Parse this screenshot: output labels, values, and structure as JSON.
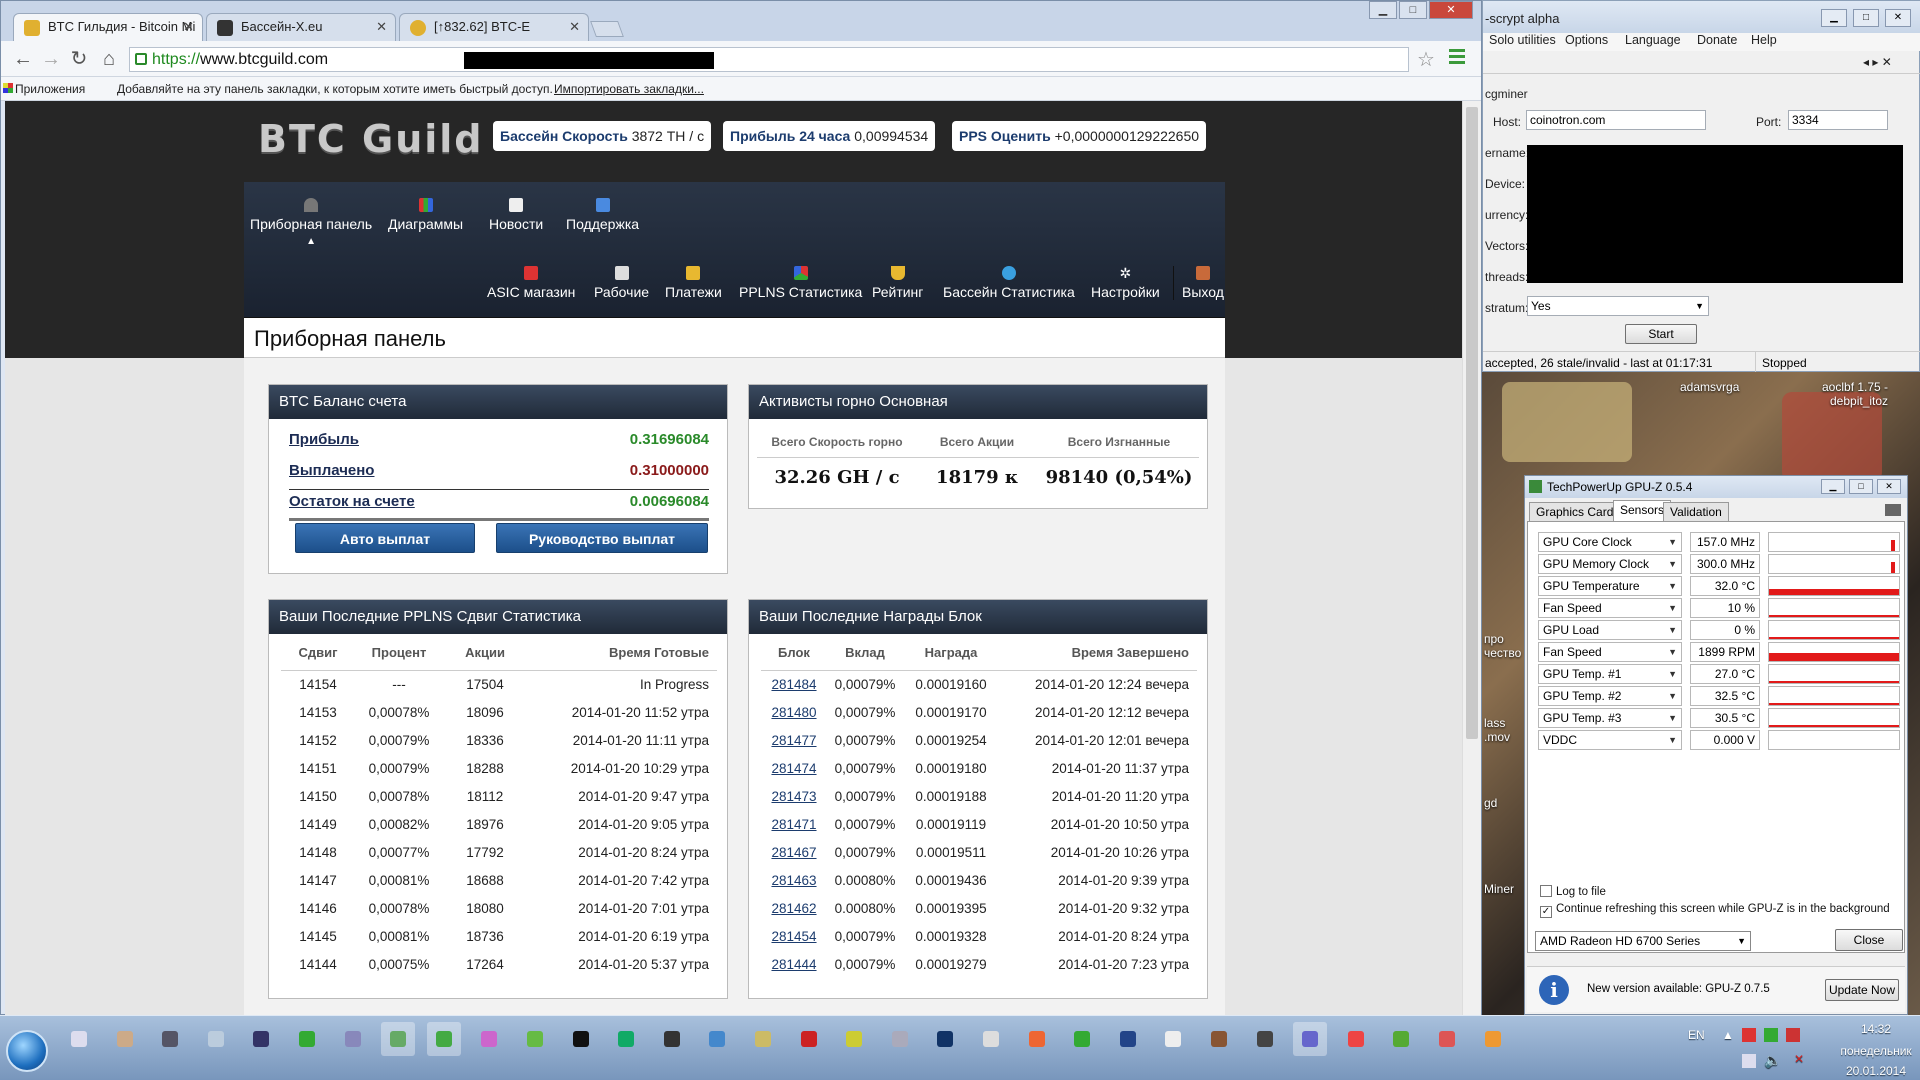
{
  "browser": {
    "tabs": [
      {
        "label": "BTC Гильдия - Bitcoin Mi",
        "favicon": "#e0b030",
        "active": true
      },
      {
        "label": "Бассейн-X.eu",
        "favicon": "#333333",
        "active": false
      },
      {
        "label": "[↑832.62] BTC-E",
        "favicon": "#e0b030",
        "active": false
      }
    ],
    "url_scheme": "https://",
    "url_host": "www.btcguild.com",
    "bookmarks_apps": "Приложения",
    "bookmarks_hint": "Добавляйте на эту панель закладки, к которым хотите иметь быстрый доступ.",
    "bookmarks_import": "Импортировать закладки..."
  },
  "site": {
    "logo": "BTC Guild",
    "stats": [
      {
        "label": "Бассейн Скорость",
        "value": "3872 TH / с"
      },
      {
        "label": "Прибыль 24 часа",
        "value": "0,00994534"
      },
      {
        "label": "PPS Оценить",
        "value": "+0,0000000129222650"
      }
    ],
    "nav_top": [
      "Приборная панель",
      "Диаграммы",
      "Новости",
      "Поддержка"
    ],
    "nav_bottom": [
      "ASIC магазин",
      "Рабочие",
      "Платежи",
      "PPLNS Статистика",
      "Рейтинг",
      "Бассейн Статистика",
      "Настройки",
      "Выход"
    ],
    "page_title": "Приборная панель",
    "balance": {
      "title": "BTC Баланс счета",
      "rows": [
        {
          "label": "Прибыль",
          "value": "0.31696084",
          "color": "#2a8a2a"
        },
        {
          "label": "Выплачено",
          "value": "0.31000000",
          "color": "#8a1a1a"
        },
        {
          "label": "Остаток на счете",
          "value": "0.00696084",
          "color": "#2a8a2a"
        }
      ],
      "btn_auto": "Авто выплат",
      "btn_guide": "Руководство выплат"
    },
    "activity": {
      "title": "Активисты горно Основная",
      "headers": [
        "Всего Скорость горно",
        "Всего Акции",
        "Всего Изгнанные"
      ],
      "values": [
        "32.26 GH / с",
        "18179 к",
        "98140 (0,54%)"
      ]
    },
    "pplns": {
      "title": "Ваши Последние PPLNS Сдвиг Статистика",
      "headers": [
        "Сдвиг",
        "Процент",
        "Акции",
        "Время Готовые"
      ],
      "rows": [
        [
          "14154",
          "---",
          "17504",
          "In Progress"
        ],
        [
          "14153",
          "0,00078%",
          "18096",
          "2014-01-20 11:52 утра"
        ],
        [
          "14152",
          "0,00079%",
          "18336",
          "2014-01-20 11:11 утра"
        ],
        [
          "14151",
          "0,00079%",
          "18288",
          "2014-01-20 10:29 утра"
        ],
        [
          "14150",
          "0,00078%",
          "18112",
          "2014-01-20 9:47 утра"
        ],
        [
          "14149",
          "0,00082%",
          "18976",
          "2014-01-20 9:05 утра"
        ],
        [
          "14148",
          "0,00077%",
          "17792",
          "2014-01-20 8:24 утра"
        ],
        [
          "14147",
          "0,00081%",
          "18688",
          "2014-01-20 7:42 утра"
        ],
        [
          "14146",
          "0,00078%",
          "18080",
          "2014-01-20 7:01 утра"
        ],
        [
          "14145",
          "0,00081%",
          "18736",
          "2014-01-20 6:19 утра"
        ],
        [
          "14144",
          "0,00075%",
          "17264",
          "2014-01-20 5:37 утра"
        ]
      ]
    },
    "blocks": {
      "title": "Ваши Последние Награды Блок",
      "headers": [
        "Блок",
        "Вклад",
        "Награда",
        "Время Завершено"
      ],
      "rows": [
        [
          "281484",
          "0,00079%",
          "0.00019160",
          "2014-01-20 12:24 вечера"
        ],
        [
          "281480",
          "0,00079%",
          "0.00019170",
          "2014-01-20 12:12 вечера"
        ],
        [
          "281477",
          "0,00079%",
          "0.00019254",
          "2014-01-20 12:01 вечера"
        ],
        [
          "281474",
          "0,00079%",
          "0.00019180",
          "2014-01-20 11:37 утра"
        ],
        [
          "281473",
          "0,00079%",
          "0.00019188",
          "2014-01-20 11:20 утра"
        ],
        [
          "281471",
          "0,00079%",
          "0.00019119",
          "2014-01-20 10:50 утра"
        ],
        [
          "281467",
          "0,00079%",
          "0.00019511",
          "2014-01-20 10:26 утра"
        ],
        [
          "281463",
          "0.00080%",
          "0.00019436",
          "2014-01-20 9:39 утра"
        ],
        [
          "281462",
          "0.00080%",
          "0.00019395",
          "2014-01-20 9:32 утра"
        ],
        [
          "281454",
          "0,00079%",
          "0.00019328",
          "2014-01-20 8:24 утра"
        ],
        [
          "281444",
          "0,00079%",
          "0.00019279",
          "2014-01-20 7:23 утра"
        ]
      ]
    }
  },
  "cgminer": {
    "title": "-scrypt alpha",
    "menu": [
      "Solo utilities",
      "Options",
      "Language",
      "Donate",
      "Help"
    ],
    "section": "cgminer",
    "host_label": "Host:",
    "host": "coinotron.com",
    "port_label": "Port:",
    "port": "3334",
    "labels": [
      "ername:",
      "Device:",
      "urrency:",
      "Vectors:",
      "threads:",
      "stratum:"
    ],
    "stratum_value": "Yes",
    "start": "Start",
    "status_left": "accepted, 26 stale/invalid - last at 01:17:31",
    "status_right": "Stopped"
  },
  "desktop": {
    "labels": [
      "adamsvrga",
      "aoclbf 1.75 -",
      "debpit_itoz",
      "про",
      "чество",
      "lass",
      ".mov",
      "gd",
      "Miner"
    ]
  },
  "gpuz": {
    "title": "TechPowerUp GPU-Z 0.5.4",
    "tabs": [
      "Graphics Card",
      "Sensors",
      "Validation"
    ],
    "sensors": [
      {
        "name": "GPU Core Clock",
        "value": "157.0 MHz",
        "level": 0.1
      },
      {
        "name": "GPU Memory Clock",
        "value": "300.0 MHz",
        "level": 0.15
      },
      {
        "name": "GPU Temperature",
        "value": "32.0 °C",
        "level": 0.3
      },
      {
        "name": "Fan Speed",
        "value": "10 %",
        "level": 0.1
      },
      {
        "name": "GPU Load",
        "value": "0 %",
        "level": 0.02
      },
      {
        "name": "Fan Speed",
        "value": "1899 RPM",
        "level": 0.4
      },
      {
        "name": "GPU Temp. #1",
        "value": "27.0 °C",
        "level": 0.12
      },
      {
        "name": "GPU Temp. #2",
        "value": "32.5 °C",
        "level": 0.12
      },
      {
        "name": "GPU Temp. #3",
        "value": "30.5 °C",
        "level": 0.12
      },
      {
        "name": "VDDC",
        "value": "0.000 V",
        "level": 0
      }
    ],
    "log_to_file": "Log to file",
    "continue_refresh": "Continue refreshing this screen while GPU-Z is in the background",
    "card": "AMD Radeon HD 6700 Series",
    "close": "Close",
    "update_text": "New version available: GPU-Z 0.7.5",
    "update_btn": "Update Now"
  },
  "taskbar": {
    "lang": "EN",
    "time": "14:32",
    "day": "понедельник",
    "date": "20.01.2014"
  }
}
